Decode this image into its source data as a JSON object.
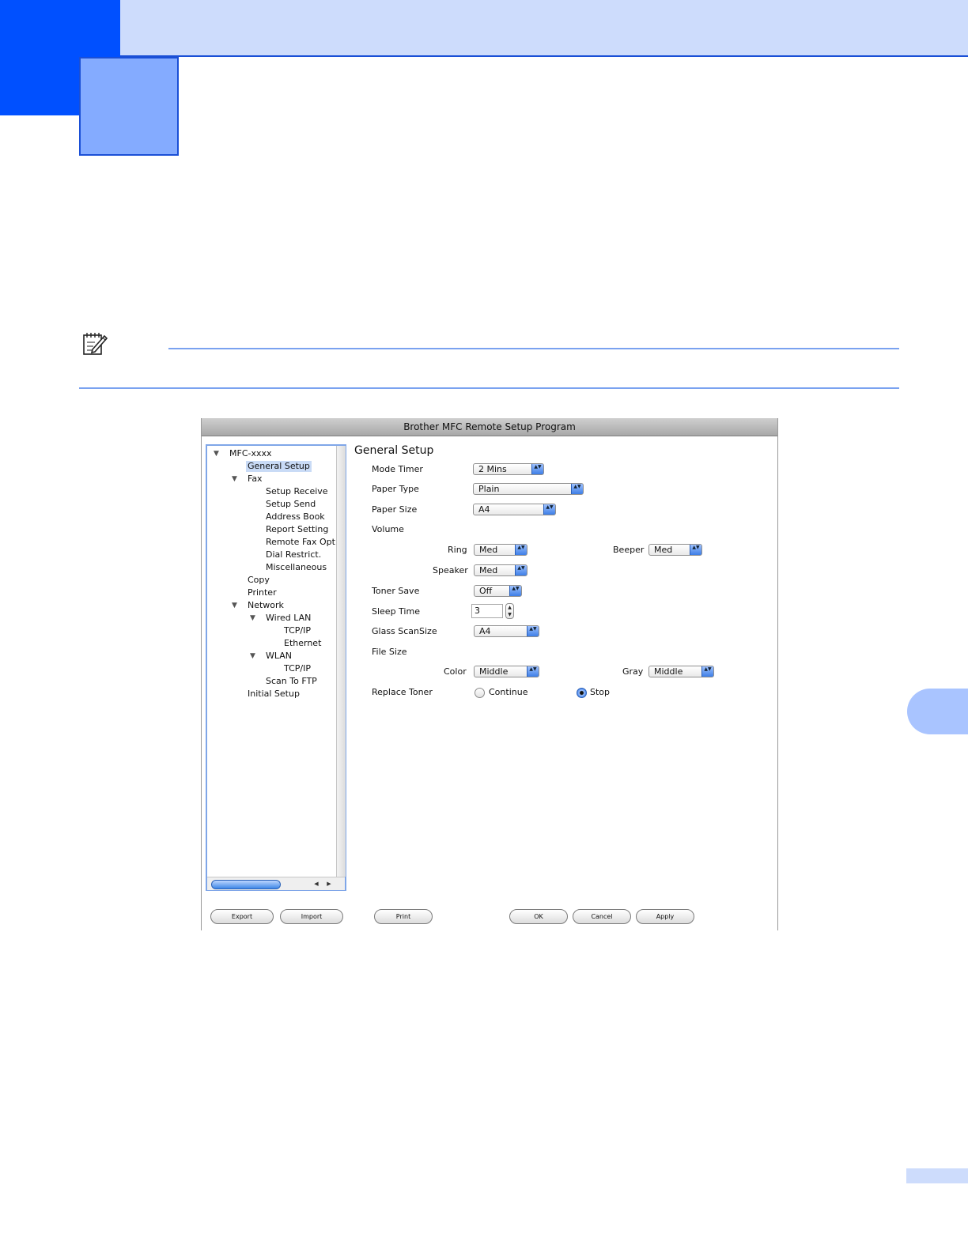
{
  "dialog": {
    "title": "Brother MFC Remote Setup Program",
    "tree": {
      "items": [
        {
          "label": "MFC-xxxx",
          "expanded": true
        },
        {
          "label": "General Setup",
          "selected": true
        },
        {
          "label": "Fax",
          "expanded": true
        },
        {
          "label": "Setup Receive"
        },
        {
          "label": "Setup Send"
        },
        {
          "label": "Address Book"
        },
        {
          "label": "Report Setting"
        },
        {
          "label": "Remote Fax Opt"
        },
        {
          "label": "Dial Restrict."
        },
        {
          "label": "Miscellaneous"
        },
        {
          "label": "Copy"
        },
        {
          "label": "Printer"
        },
        {
          "label": "Network",
          "expanded": true
        },
        {
          "label": "Wired LAN",
          "expanded": true
        },
        {
          "label": "TCP/IP"
        },
        {
          "label": "Ethernet"
        },
        {
          "label": "WLAN",
          "expanded": true
        },
        {
          "label": "TCP/IP"
        },
        {
          "label": "Scan To FTP"
        },
        {
          "label": "Initial Setup"
        }
      ],
      "expand_glyph": "▼",
      "scroll_left_glyph": "◀",
      "scroll_right_glyph": "▶"
    },
    "panel": {
      "title": "General Setup",
      "mode_timer": {
        "label": "Mode Timer",
        "value": "2 Mins"
      },
      "paper_type": {
        "label": "Paper Type",
        "value": "Plain"
      },
      "paper_size": {
        "label": "Paper Size",
        "value": "A4"
      },
      "volume": {
        "label": "Volume",
        "ring": {
          "label": "Ring",
          "value": "Med"
        },
        "beeper": {
          "label": "Beeper",
          "value": "Med"
        },
        "speaker": {
          "label": "Speaker",
          "value": "Med"
        }
      },
      "toner_save": {
        "label": "Toner Save",
        "value": "Off"
      },
      "sleep_time": {
        "label": "Sleep Time",
        "value": "3"
      },
      "glass_scansize": {
        "label": "Glass ScanSize",
        "value": "A4"
      },
      "file_size": {
        "label": "File Size",
        "color": {
          "label": "Color",
          "value": "Middle"
        },
        "gray": {
          "label": "Gray",
          "value": "Middle"
        }
      },
      "replace_toner": {
        "label": "Replace Toner",
        "options": [
          "Continue",
          "Stop"
        ],
        "selected": "Stop"
      }
    },
    "buttons": {
      "export": "Export",
      "import": "Import",
      "print": "Print",
      "ok": "OK",
      "cancel": "Cancel",
      "apply": "Apply"
    },
    "glyphs": {
      "select_arrows": "▲▼",
      "stepper_up": "▲",
      "stepper_down": "▼"
    }
  },
  "colors": {
    "header_band": "#cddcfc",
    "brand_blue": "#0050ff",
    "chapter_box": "#84abff",
    "rule": "#7aa2f0"
  },
  "icons": {
    "note": "note-pencil-icon"
  }
}
